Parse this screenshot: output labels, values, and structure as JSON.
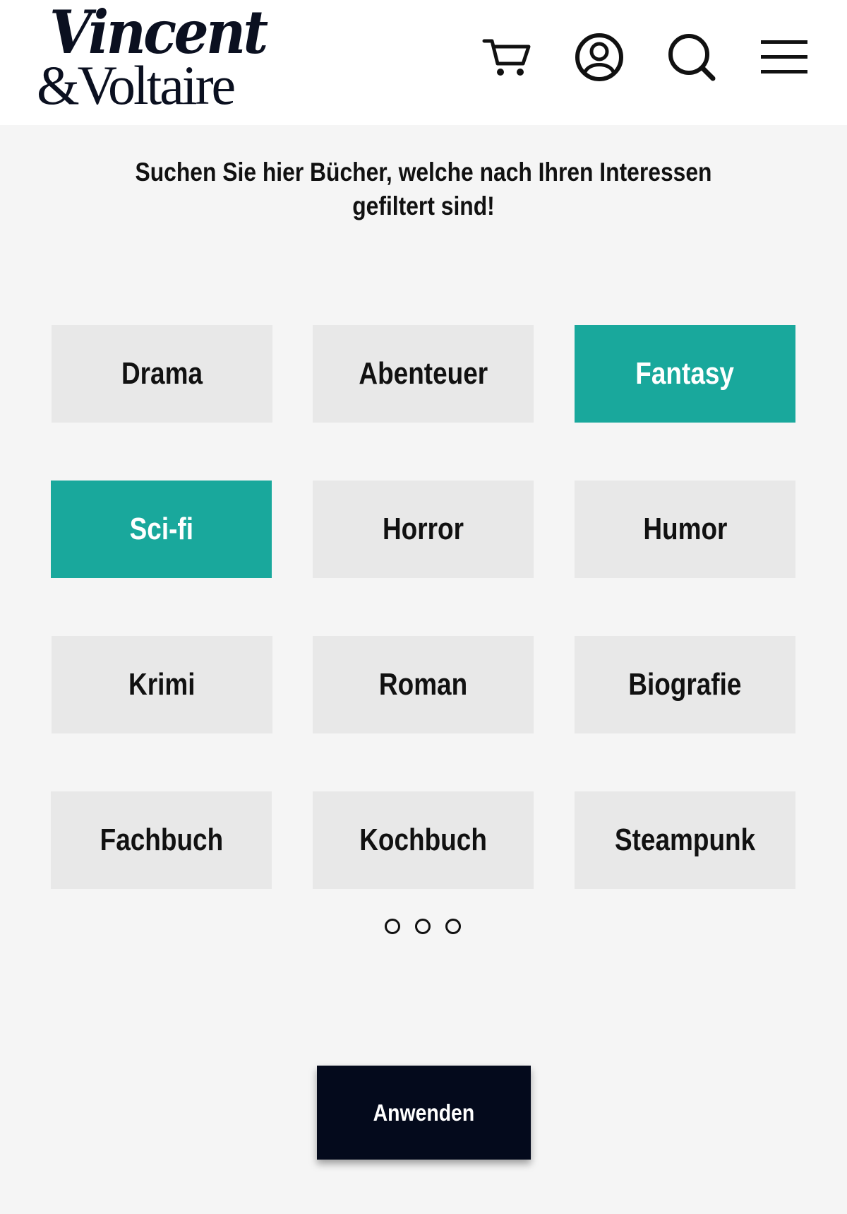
{
  "brand": {
    "line1": "Vincent",
    "line2": "&Voltaire"
  },
  "header_icons": [
    "cart-icon",
    "account-icon",
    "search-icon",
    "menu-icon"
  ],
  "headline": "Suchen Sie hier Bücher, welche nach Ihren  Interessen gefiltert sind!",
  "genres": [
    {
      "label": "Drama",
      "selected": false
    },
    {
      "label": "Abenteuer",
      "selected": false
    },
    {
      "label": "Fantasy",
      "selected": true
    },
    {
      "label": "Sci-fi",
      "selected": true
    },
    {
      "label": "Horror",
      "selected": false
    },
    {
      "label": "Humor",
      "selected": false
    },
    {
      "label": "Krimi",
      "selected": false
    },
    {
      "label": "Roman",
      "selected": false
    },
    {
      "label": "Biografie",
      "selected": false
    },
    {
      "label": "Fachbuch",
      "selected": false
    },
    {
      "label": "Kochbuch",
      "selected": false
    },
    {
      "label": "Steampunk",
      "selected": false
    }
  ],
  "pagination": {
    "pages": 3
  },
  "apply_label": "Anwenden",
  "colors": {
    "accent": "#19a89c",
    "tile": "#e8e8e8",
    "button": "#040a1c",
    "background": "#f5f5f5"
  }
}
